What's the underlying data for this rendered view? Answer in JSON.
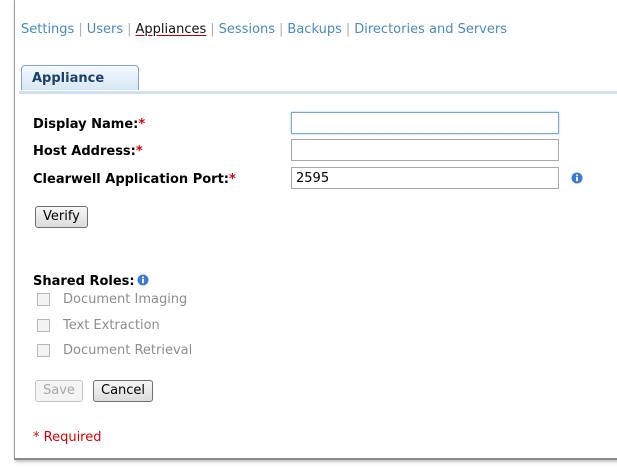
{
  "nav": {
    "items": [
      {
        "label": "Settings"
      },
      {
        "label": "Users"
      },
      {
        "label": "Appliances"
      },
      {
        "label": "Sessions"
      },
      {
        "label": "Backups"
      },
      {
        "label": "Directories and Servers"
      }
    ],
    "separator": "|",
    "active_index": 2
  },
  "tab": {
    "label": "Appliance"
  },
  "form": {
    "display_name": {
      "label": "Display Name:",
      "required_mark": "*",
      "value": ""
    },
    "host_address": {
      "label": "Host Address:",
      "required_mark": "*",
      "value": ""
    },
    "port": {
      "label": "Clearwell Application Port:",
      "required_mark": "*",
      "value": "2595"
    },
    "verify_label": "Verify",
    "shared_roles_label": "Shared Roles:",
    "roles": [
      {
        "label": "Document Imaging",
        "checked": false
      },
      {
        "label": "Text Extraction",
        "checked": false
      },
      {
        "label": "Document Retrieval",
        "checked": false
      }
    ],
    "save_label": "Save",
    "cancel_label": "Cancel",
    "required_note": "* Required"
  },
  "colors": {
    "link": "#4a8bbf",
    "required": "#e00000",
    "tab_text": "#1d3f6e",
    "info_icon": "#3a7bd5"
  },
  "icons": {
    "info": "info-icon"
  }
}
